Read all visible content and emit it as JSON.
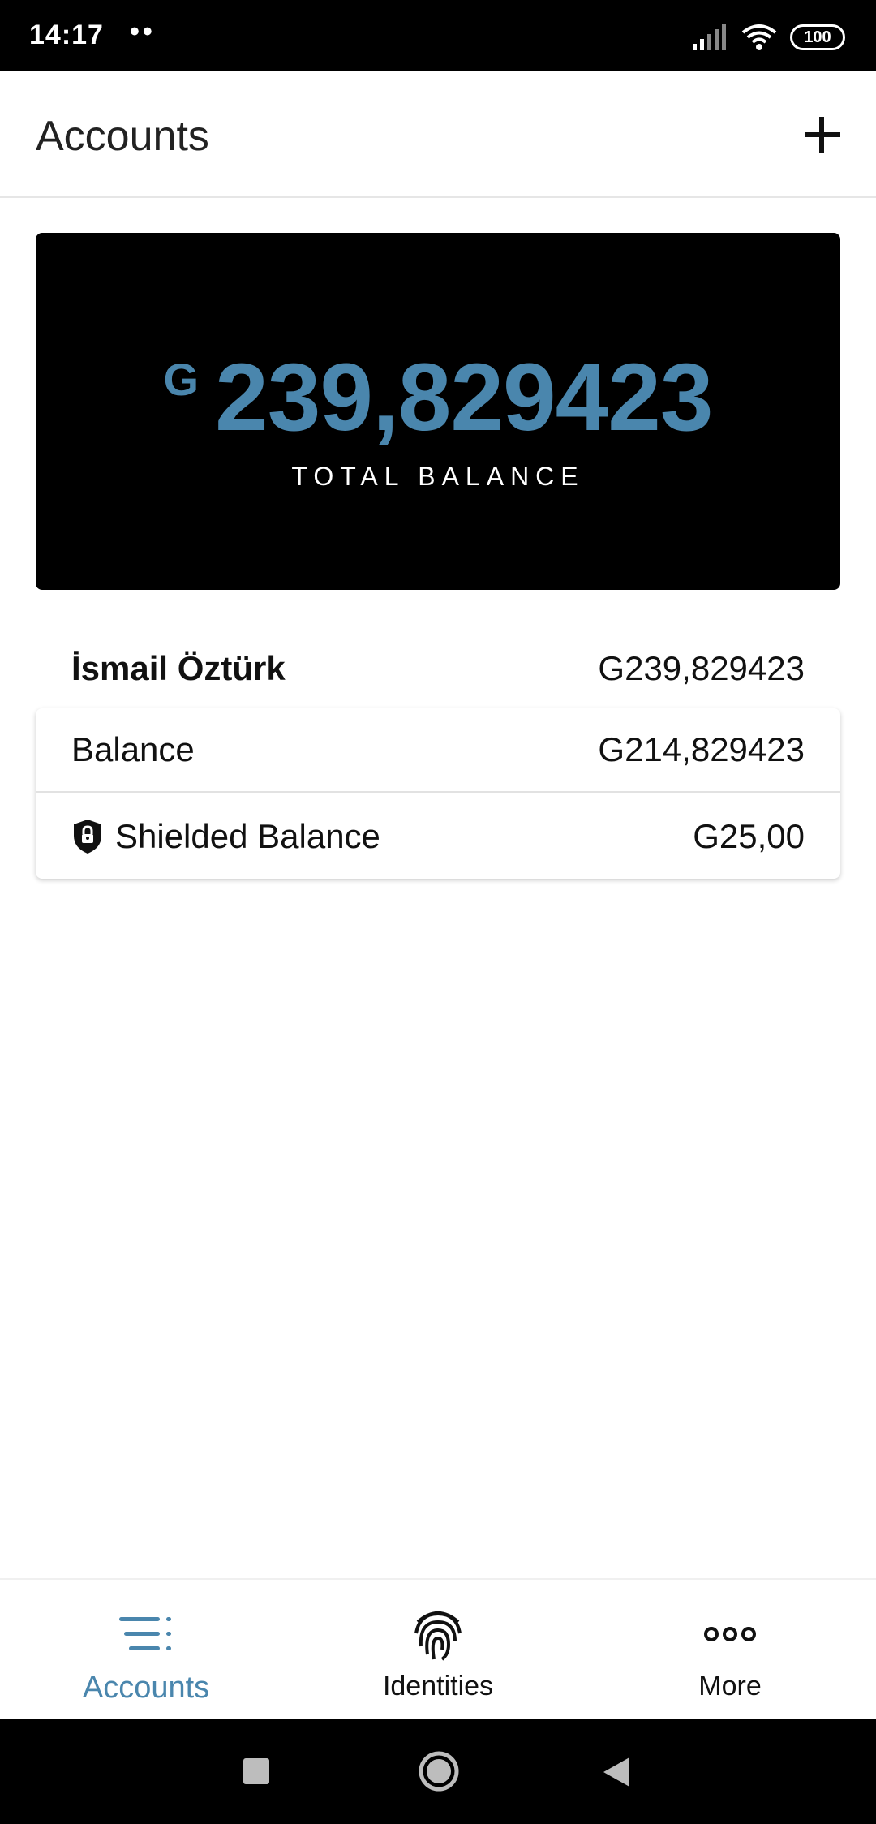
{
  "status_bar": {
    "time": "14:17",
    "dots": "••",
    "battery": "100"
  },
  "header": {
    "title": "Accounts"
  },
  "total_card": {
    "currency": "G",
    "amount": "239,829423",
    "label": "TOTAL BALANCE"
  },
  "account": {
    "name": "İsmail Öztürk",
    "total": "G239,829423",
    "rows": [
      {
        "label": "Balance",
        "value": "G214,829423"
      },
      {
        "label": "Shielded Balance",
        "value": "G25,00"
      }
    ]
  },
  "bottom_nav": [
    {
      "label": "Accounts",
      "icon": "accounts-list-icon",
      "active": true
    },
    {
      "label": "Identities",
      "icon": "fingerprint-icon",
      "active": false
    },
    {
      "label": "More",
      "icon": "more-dots-icon",
      "active": false
    }
  ],
  "colors": {
    "accent": "#4a86ad",
    "card_bg": "#000000"
  }
}
